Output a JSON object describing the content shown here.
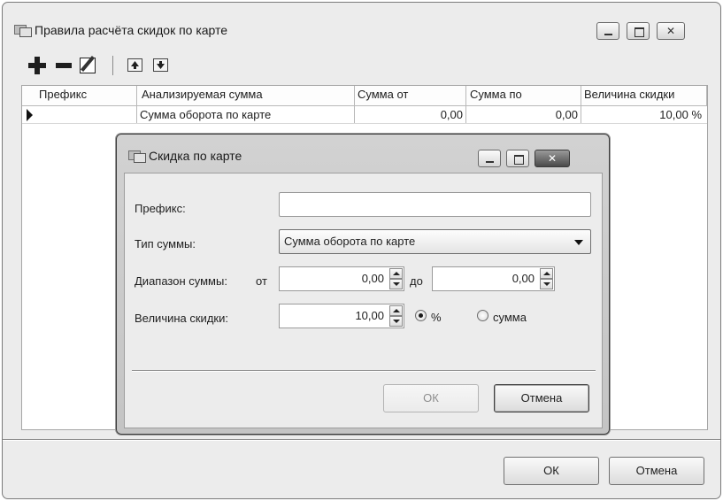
{
  "window": {
    "title": "Правила расчёта скидок по карте",
    "icon": "window-icon",
    "controls": [
      "minimize",
      "maximize",
      "close"
    ]
  },
  "toolbar": {
    "items": [
      {
        "name": "add",
        "icon": "plus-icon"
      },
      {
        "name": "delete",
        "icon": "minus-icon"
      },
      {
        "name": "edit",
        "icon": "pencil-icon"
      },
      {
        "name": "move-up",
        "icon": "arrow-up-icon"
      },
      {
        "name": "move-down",
        "icon": "arrow-down-icon"
      }
    ]
  },
  "grid": {
    "columns": [
      "Префикс",
      "Анализируемая сумма",
      "Сумма от",
      "Сумма по",
      "Величина скидки"
    ],
    "rows": [
      [
        "",
        "Сумма оборота по карте",
        "0,00",
        "0,00",
        "10,00 %"
      ]
    ]
  },
  "dialog": {
    "title": "Скидка по карте",
    "prefix_label": "Префикс:",
    "prefix_value": "",
    "sum_type_label": "Тип суммы:",
    "sum_type_value": "Сумма оборота по карте",
    "range_label": "Диапазон суммы:",
    "range_from_label": "от",
    "range_from_value": "0,00",
    "range_to_label": "до",
    "range_to_value": "0,00",
    "discount_label": "Величина скидки:",
    "discount_value": "10,00",
    "discount_type_options": [
      {
        "label": "%",
        "selected": true
      },
      {
        "label": "сумма",
        "selected": false
      }
    ],
    "ok_label": "ОК",
    "ok_enabled": false,
    "cancel_label": "Отмена"
  },
  "footer": {
    "ok_label": "ОК",
    "cancel_label": "Отмена"
  }
}
